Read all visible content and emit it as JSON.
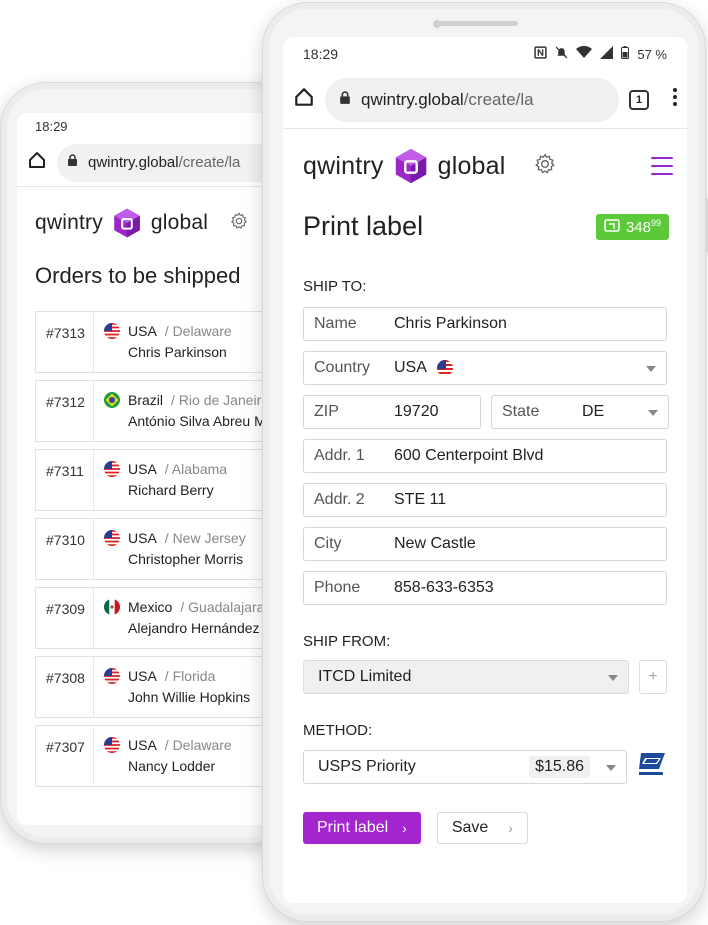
{
  "back_phone": {
    "status": {
      "time": "18:29"
    },
    "browser": {
      "url_domain": "qwintry.global",
      "url_path": "/create/la"
    },
    "brand": {
      "left": "qwintry",
      "right": "global"
    },
    "title": "Orders to be shipped",
    "orders": [
      {
        "id": "#7313",
        "country": "USA",
        "region": "/ Delaware",
        "name": "Chris Parkinson",
        "flag": "us"
      },
      {
        "id": "#7312",
        "country": "Brazil",
        "region": "/ Rio de Janeiro",
        "name": "António Silva Abreu M",
        "flag": "br"
      },
      {
        "id": "#7311",
        "country": "USA",
        "region": "/ Alabama",
        "name": "Richard Berry",
        "flag": "us"
      },
      {
        "id": "#7310",
        "country": "USA",
        "region": "/ New Jersey",
        "name": "Christopher Morris",
        "flag": "us"
      },
      {
        "id": "#7309",
        "country": "Mexico",
        "region": "/ Guadalajara",
        "name": "Alejandro Hernández",
        "flag": "mx"
      },
      {
        "id": "#7308",
        "country": "USA",
        "region": "/ Florida",
        "name": "John Willie Hopkins",
        "flag": "us"
      },
      {
        "id": "#7307",
        "country": "USA",
        "region": "/ Delaware",
        "name": "Nancy Lodder",
        "flag": "us"
      }
    ]
  },
  "front_phone": {
    "status": {
      "time": "18:29",
      "battery": "57 %"
    },
    "browser": {
      "url_domain": "qwintry.global",
      "url_path": "/create/la",
      "tab_count": "1"
    },
    "brand": {
      "left": "qwintry",
      "right": "global"
    },
    "title": "Print label",
    "balance": {
      "whole": "348",
      "cents": "99"
    },
    "ship_to": {
      "label": "SHIP TO:",
      "name": {
        "label": "Name",
        "value": "Chris Parkinson"
      },
      "country": {
        "label": "Country",
        "value": "USA"
      },
      "zip": {
        "label": "ZIP",
        "value": "19720"
      },
      "state": {
        "label": "State",
        "value": "DE"
      },
      "addr1": {
        "label": "Addr. 1",
        "value": "600 Centerpoint Blvd"
      },
      "addr2": {
        "label": "Addr. 2",
        "value": "STE 11"
      },
      "city": {
        "label": "City",
        "value": "New Castle"
      },
      "phone": {
        "label": "Phone",
        "value": "858-633-6353"
      }
    },
    "ship_from": {
      "label": "SHIP FROM:",
      "value": "ITCD Limited",
      "add": "+"
    },
    "method": {
      "label": "METHOD:",
      "value": "USPS Priority",
      "price": "$15.86"
    },
    "actions": {
      "print": "Print label",
      "save": "Save"
    }
  },
  "colors": {
    "accent": "#a326cf",
    "balance": "#5cc93a"
  },
  "icons": [
    "home-icon",
    "lock-icon",
    "tab-switcher-icon",
    "more-vert-icon",
    "gear-icon",
    "hamburger-menu-icon",
    "wallet-icon",
    "usps-logo-icon",
    "nfc-icon",
    "mute-icon",
    "wifi-icon",
    "signal-icon",
    "battery-icon"
  ]
}
